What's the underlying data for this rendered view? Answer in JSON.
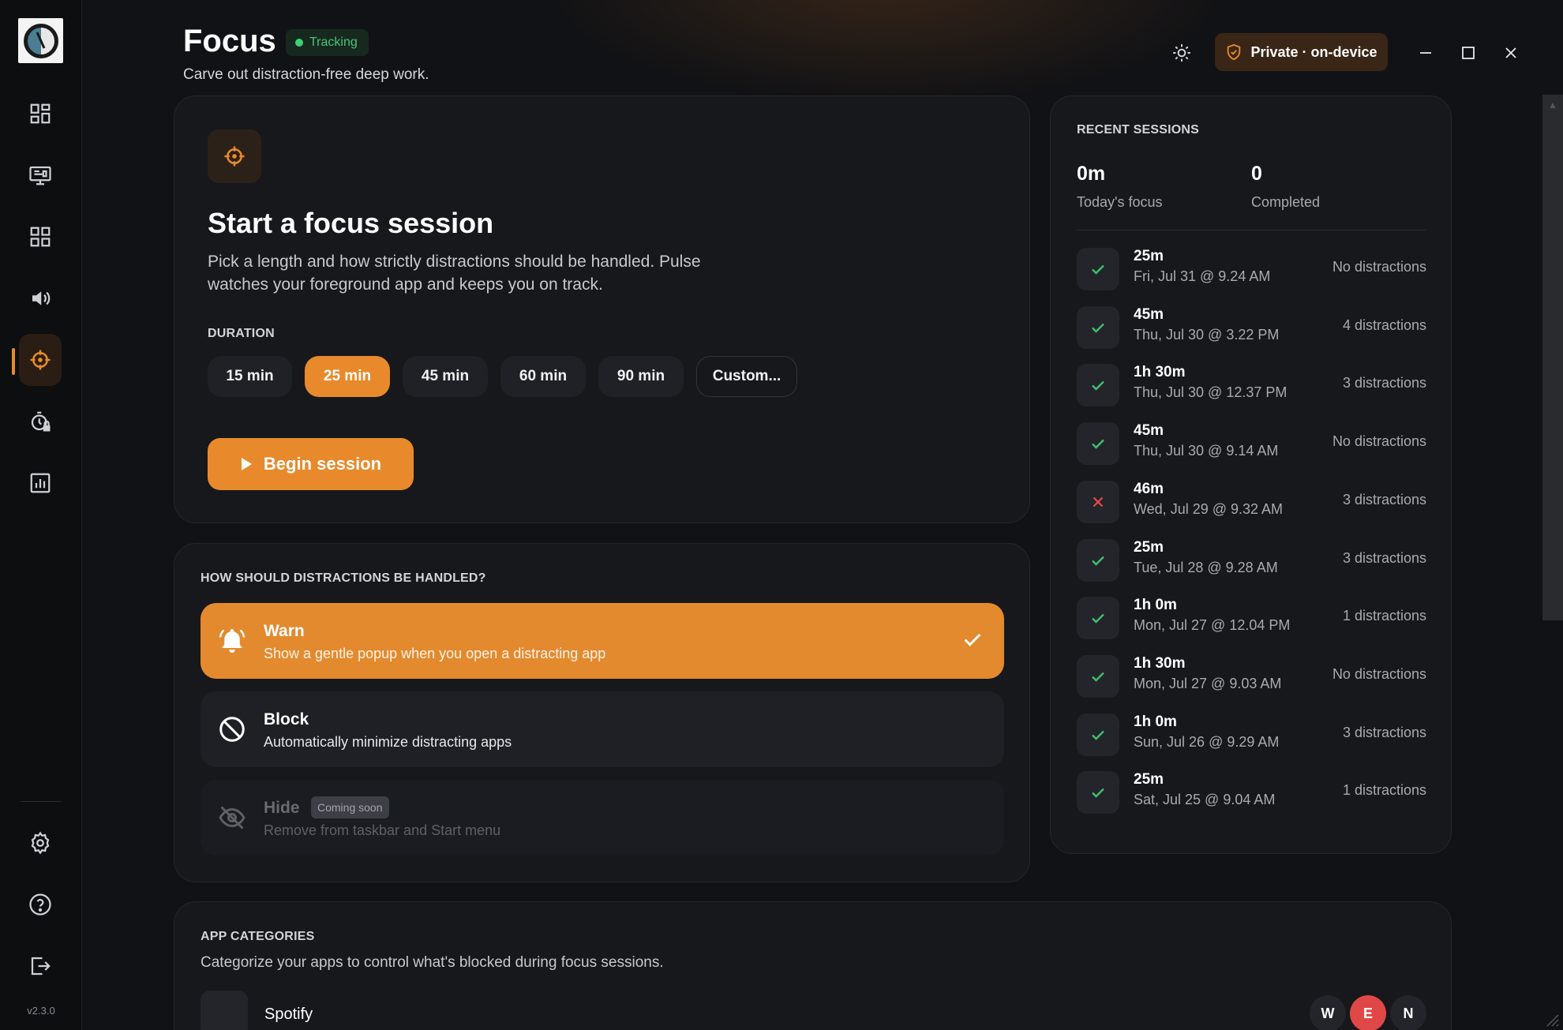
{
  "app": {
    "title": "Focus",
    "status_badge": "Tracking",
    "subtitle": "Carve out distraction-free deep work.",
    "privacy_label": "Private · on-device",
    "version": "v2.3.0"
  },
  "sidebar": {
    "items": [
      {
        "name": "dashboard",
        "icon": "dashboard-icon"
      },
      {
        "name": "screen-time",
        "icon": "monitor-icon"
      },
      {
        "name": "apps",
        "icon": "apps-grid-icon"
      },
      {
        "name": "sound",
        "icon": "speaker-icon"
      },
      {
        "name": "focus",
        "icon": "crosshair-icon",
        "active": true
      },
      {
        "name": "limits",
        "icon": "timer-lock-icon"
      },
      {
        "name": "reports",
        "icon": "bar-chart-icon"
      }
    ],
    "bottom": [
      {
        "name": "settings",
        "icon": "gear-icon"
      },
      {
        "name": "help",
        "icon": "help-icon"
      },
      {
        "name": "logout",
        "icon": "logout-icon"
      }
    ]
  },
  "focus_session": {
    "title": "Start a focus session",
    "description": "Pick a length and how strictly distractions should be handled. Pulse watches your foreground app and keeps you on track.",
    "duration_label": "DURATION",
    "durations": [
      "15 min",
      "25 min",
      "45 min",
      "60 min",
      "90 min",
      "Custom..."
    ],
    "selected_duration": "25 min",
    "begin_label": "Begin session"
  },
  "distraction_modes": {
    "label": "HOW SHOULD DISTRACTIONS BE HANDLED?",
    "options": [
      {
        "name": "Warn",
        "description": "Show a gentle popup when you open a distracting app",
        "selected": true
      },
      {
        "name": "Block",
        "description": "Automatically minimize distracting apps",
        "selected": false
      },
      {
        "name": "Hide",
        "description": "Remove from taskbar and Start menu",
        "badge": "Coming soon",
        "disabled": true
      }
    ]
  },
  "recent_sessions": {
    "label": "RECENT SESSIONS",
    "today_focus_value": "0m",
    "today_focus_label": "Today's focus",
    "completed_value": "0",
    "completed_label": "Completed",
    "sessions": [
      {
        "duration": "25m",
        "date": "Fri, Jul 31 @ 9.24 AM",
        "distractions": "No distractions",
        "status": "completed"
      },
      {
        "duration": "45m",
        "date": "Thu, Jul 30 @ 3.22 PM",
        "distractions": "4 distractions",
        "status": "completed"
      },
      {
        "duration": "1h 30m",
        "date": "Thu, Jul 30 @ 12.37 PM",
        "distractions": "3 distractions",
        "status": "completed"
      },
      {
        "duration": "45m",
        "date": "Thu, Jul 30 @ 9.14 AM",
        "distractions": "No distractions",
        "status": "completed"
      },
      {
        "duration": "46m",
        "date": "Wed, Jul 29 @ 9.32 AM",
        "distractions": "3 distractions",
        "status": "failed"
      },
      {
        "duration": "25m",
        "date": "Tue, Jul 28 @ 9.28 AM",
        "distractions": "3 distractions",
        "status": "completed"
      },
      {
        "duration": "1h 0m",
        "date": "Mon, Jul 27 @ 12.04 PM",
        "distractions": "1 distractions",
        "status": "completed"
      },
      {
        "duration": "1h 30m",
        "date": "Mon, Jul 27 @ 9.03 AM",
        "distractions": "No distractions",
        "status": "completed"
      },
      {
        "duration": "1h 0m",
        "date": "Sun, Jul 26 @ 9.29 AM",
        "distractions": "3 distractions",
        "status": "completed"
      },
      {
        "duration": "25m",
        "date": "Sat, Jul 25 @ 9.04 AM",
        "distractions": "1 distractions",
        "status": "completed"
      }
    ]
  },
  "app_categories": {
    "label": "APP CATEGORIES",
    "description": "Categorize your apps to control what's blocked during focus sessions.",
    "apps": [
      {
        "name": "Spotify",
        "categories": [
          "W",
          "E",
          "N"
        ],
        "selected": "E"
      }
    ]
  },
  "colors": {
    "accent": "#e88a2c",
    "success": "#3fbf6f",
    "danger": "#e24b4b",
    "background": "#111215",
    "card": "#17181c"
  }
}
